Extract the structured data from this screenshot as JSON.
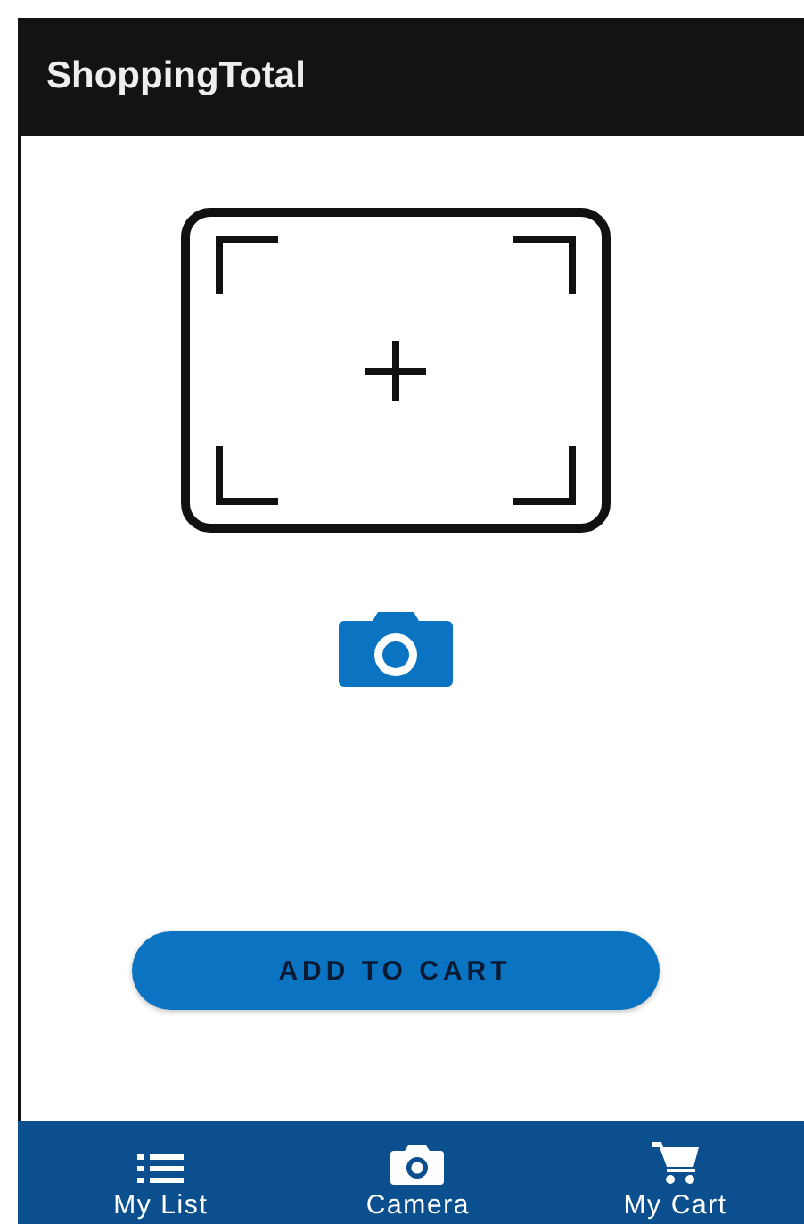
{
  "app_bar": {
    "title": "ShoppingTotal"
  },
  "action_button": {
    "label": "ADD TO CART"
  },
  "bottom_nav": [
    {
      "kind": "list",
      "label": "My List"
    },
    {
      "kind": "camera",
      "label": "Camera"
    },
    {
      "kind": "cart",
      "label": "My Cart"
    }
  ]
}
